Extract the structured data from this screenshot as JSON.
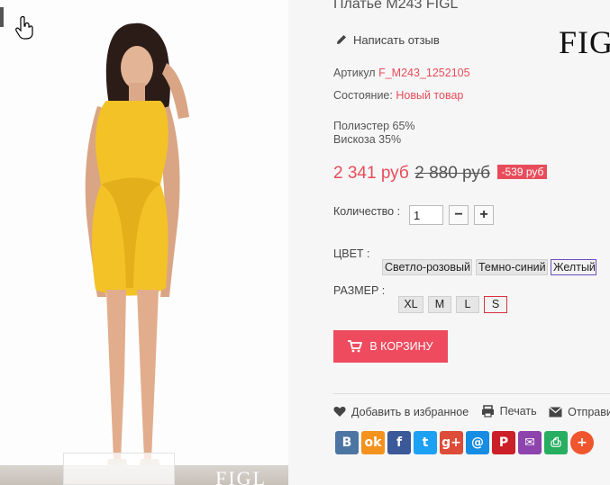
{
  "product": {
    "title": "Платье M243 FIGL",
    "brand_logo": "FIGL",
    "photo_watermark": "FIGL",
    "write_review": "Написать отзыв",
    "sku_label": "Артикул",
    "sku_value": "F_M243_1252105",
    "condition_label": "Состояние:",
    "condition_value": "Новый товар",
    "composition": [
      "Полиэстер 65%",
      "Вискоза 35%"
    ],
    "price_new": "2 341 руб",
    "price_old": "2 880 руб",
    "discount": "-539 руб",
    "quantity_label": "Количество :",
    "quantity_value": "1",
    "minus": "−",
    "plus": "+"
  },
  "color": {
    "label": "ЦВЕТ :",
    "options": [
      "Светло-розовый",
      "Темно-синий",
      "Желтый"
    ],
    "selected": "Желтый",
    "accent": "#6a4fbf"
  },
  "size": {
    "label": "РАЗМЕР :",
    "options": [
      "XL",
      "M",
      "L",
      "S"
    ],
    "selected": "S",
    "accent": "#d9323f"
  },
  "cart_button": "В КОРЗИНУ",
  "actions": {
    "favorite": "Добавить в избранное",
    "print": "Печать",
    "send": "Отправить"
  },
  "share_icons": [
    {
      "name": "vk-icon",
      "glyph": "В",
      "color": "#4c75a3"
    },
    {
      "name": "odnoklassniki-icon",
      "glyph": "ok",
      "color": "#f4921e"
    },
    {
      "name": "facebook-icon",
      "glyph": "f",
      "color": "#3b5998"
    },
    {
      "name": "twitter-icon",
      "glyph": "t",
      "color": "#1da1f2"
    },
    {
      "name": "google-plus-icon",
      "glyph": "g+",
      "color": "#dd4b39"
    },
    {
      "name": "mail-ru-icon",
      "glyph": "@",
      "color": "#168de2"
    },
    {
      "name": "pinterest-icon",
      "glyph": "P",
      "color": "#cb2027"
    },
    {
      "name": "email-icon",
      "glyph": "✉",
      "color": "#8e44ad"
    },
    {
      "name": "print-share-icon",
      "glyph": "⎙",
      "color": "#27ae60"
    },
    {
      "name": "more-share-icon",
      "glyph": "+",
      "color": "#f0562e"
    }
  ],
  "colors": {
    "accent": "#e84c5a",
    "cart": "#ee4b5e",
    "panel": "#f6f6f6"
  }
}
